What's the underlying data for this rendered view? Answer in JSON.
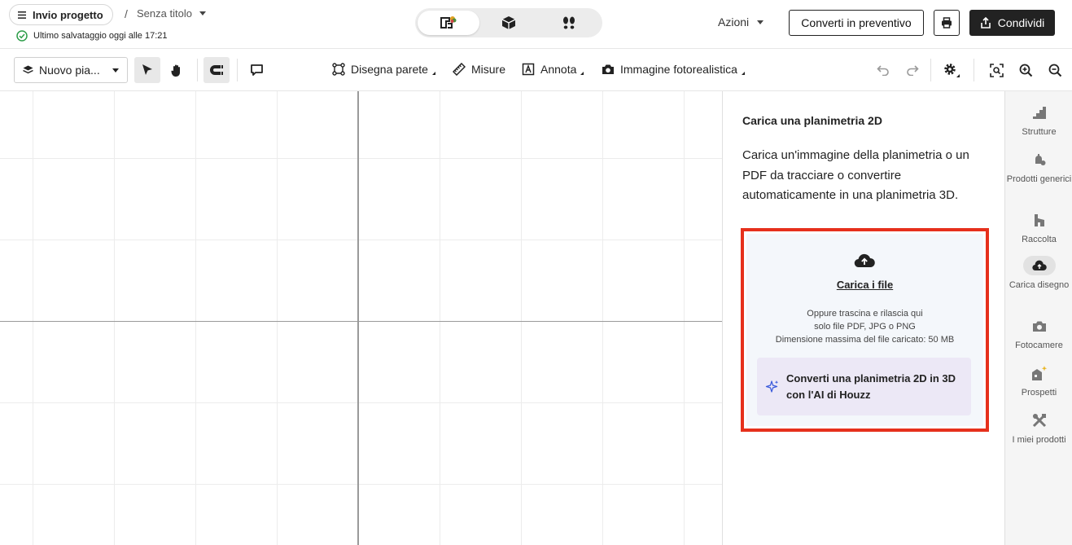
{
  "header": {
    "project_button": "Invio progetto",
    "separator": "/",
    "title": "Senza titolo",
    "save_status": "Ultimo salvataggio oggi alle 17:21",
    "actions_label": "Azioni",
    "quote_button": "Converti in preventivo",
    "share_button": "Condividi",
    "view_modes": [
      "2D floorplan view",
      "3D view",
      "walkthrough view"
    ],
    "active_view": "2D floorplan view"
  },
  "toolbar": {
    "floor_select": "Nuovo pia...",
    "draw_wall": "Disegna parete",
    "measures": "Misure",
    "annotate": "Annota",
    "photoreal": "Immagine fotorealistica"
  },
  "panel": {
    "title": "Carica una planimetria 2D",
    "description": "Carica un'immagine della planimetria o un PDF da tracciare o convertire automaticamente in una planimetria 3D.",
    "upload_link": "Carica i file",
    "drop_hint": "Oppure trascina e rilascia qui",
    "file_types": "solo file PDF, JPG o PNG",
    "max_size": "Dimensione massima del file caricato: 50 MB",
    "ai_convert": "Converti una planimetria 2D in 3D con l'AI di Houzz"
  },
  "rail": {
    "items": [
      {
        "label": "Strutture",
        "icon": "stairs-icon"
      },
      {
        "label": "Prodotti generici",
        "icon": "furniture-icon"
      },
      {
        "label": "Raccolta",
        "icon": "collection-icon"
      },
      {
        "label": "Carica disegno",
        "icon": "cloud-upload-icon",
        "active": true
      },
      {
        "label": "Fotocamere",
        "icon": "camera-icon"
      },
      {
        "label": "Prospetti",
        "icon": "elevation-icon"
      },
      {
        "label": "I miei prodotti",
        "icon": "tools-icon"
      }
    ]
  },
  "colors": {
    "highlight": "#e6301c",
    "ai_box": "#ece8f6",
    "dropzone": "#f4f7fb",
    "save_check": "#2e9e4a",
    "dark_button": "#222222"
  }
}
